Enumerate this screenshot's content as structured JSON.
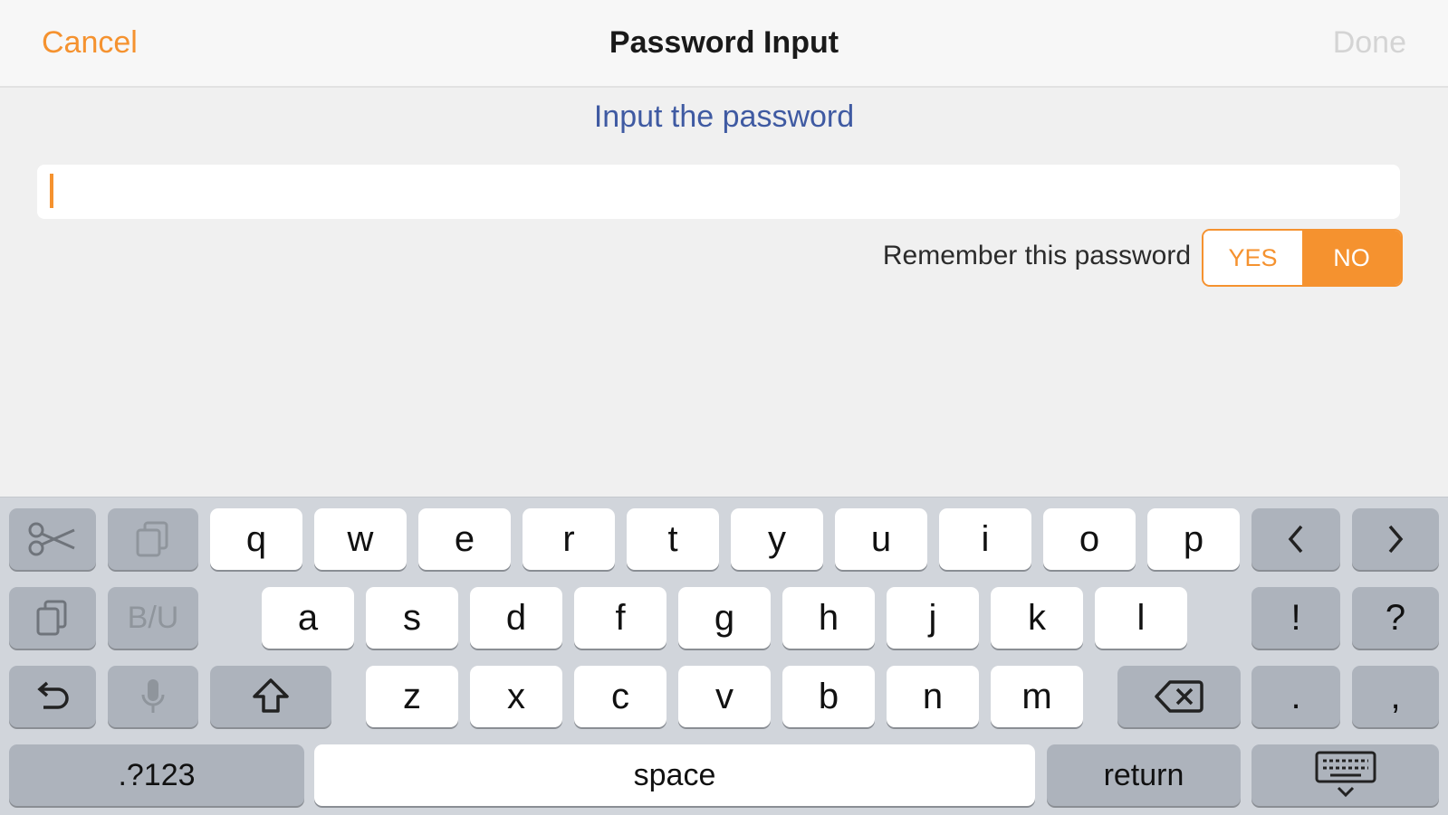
{
  "navbar": {
    "cancel_label": "Cancel",
    "title": "Password Input",
    "done_label": "Done"
  },
  "form": {
    "prompt": "Input the password",
    "password_value": "",
    "remember_label": "Remember this password",
    "remember_options": [
      "YES",
      "NO"
    ],
    "remember_selected": "NO"
  },
  "colors": {
    "accent": "#f5922f",
    "prompt": "#3f5aa2",
    "disabled": "#d4d4d4"
  },
  "keyboard": {
    "row1": [
      "q",
      "w",
      "e",
      "r",
      "t",
      "y",
      "u",
      "i",
      "o",
      "p"
    ],
    "row2": [
      "a",
      "s",
      "d",
      "f",
      "g",
      "h",
      "j",
      "k",
      "l"
    ],
    "row3": [
      "z",
      "x",
      "c",
      "v",
      "b",
      "n",
      "m"
    ],
    "bold_italic_underline_label": "B/U",
    "exclamation": "!",
    "question": "?",
    "period": ".",
    "comma": ",",
    "numbers_label": ".?123",
    "space_label": "space",
    "return_label": "return",
    "icons": [
      "scissors-icon",
      "copy-icon",
      "paste-icon",
      "undo-icon",
      "microphone-icon",
      "shift-icon",
      "backspace-icon",
      "cursor-left-icon",
      "cursor-right-icon",
      "keyboard-dismiss-icon"
    ]
  }
}
